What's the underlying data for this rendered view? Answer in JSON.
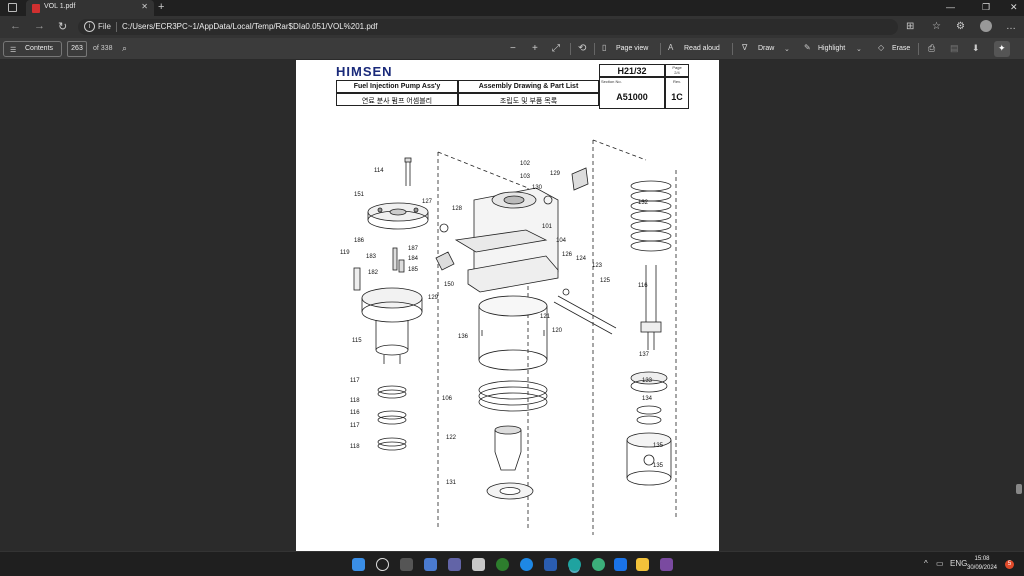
{
  "browser": {
    "tab_title": "VOL 1.pdf",
    "close_glyph": "✕",
    "new_tab_glyph": "+",
    "file_label": "File",
    "url": "C:/Users/ECR3PC~1/AppData/Local/Temp/Rar$DIa0.051/VOL%201.pdf"
  },
  "pdf_toolbar": {
    "contents_label": "Contents",
    "page_number": "263",
    "page_total": "of 338",
    "page_view_label": "Page view",
    "read_aloud_label": "Read aloud",
    "draw_label": "Draw",
    "highlight_label": "Highlight",
    "erase_label": "Erase"
  },
  "document": {
    "logo": "HIMSEN",
    "doc_code": "H21/32",
    "page_label": "Page",
    "page_of": "2/4",
    "title_en": "Fuel Injection Pump Ass'y",
    "title_kr": "연료 분사 펌프 어셈블리",
    "drawing_en": "Assembly Drawing & Part List",
    "drawing_kr": "조립도 및 부품 목록",
    "section_label": "Section No.",
    "section_no": "A51000",
    "rev_label": "Rev.",
    "rev": "1C"
  },
  "part_labels": [
    "114",
    "151",
    "186",
    "183",
    "119",
    "182",
    "187",
    "184",
    "185",
    "127",
    "128",
    "102",
    "103",
    "129",
    "130",
    "101",
    "104",
    "150",
    "126",
    "124",
    "123",
    "125",
    "129",
    "115",
    "121",
    "120",
    "132",
    "116",
    "137",
    "133",
    "134",
    "135",
    "136",
    "117",
    "118",
    "116",
    "117",
    "118",
    "106",
    "122",
    "131",
    "135"
  ],
  "taskbar": {
    "clock_time": "15:08",
    "clock_date": "30/09/2024",
    "lang": "ENG",
    "notif_count": "5"
  }
}
